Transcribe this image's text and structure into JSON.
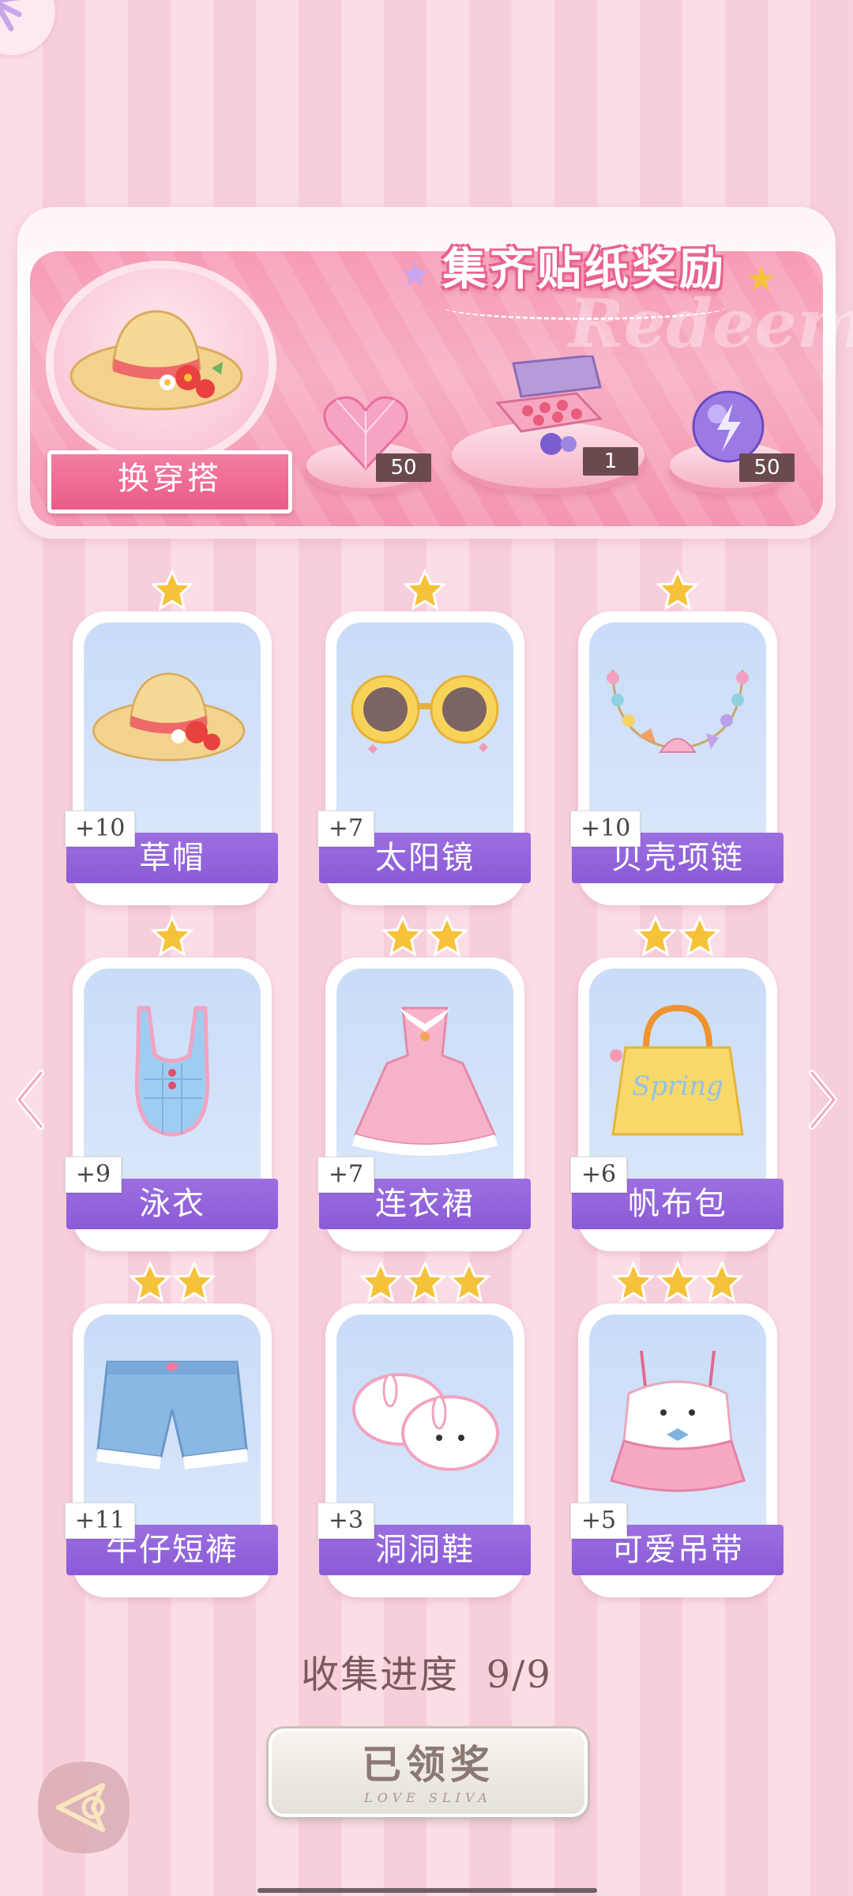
{
  "banner": {
    "title": "集齐贴纸奖励",
    "watermark": "Redeem",
    "outfit_button": "换穿搭",
    "rewards": [
      {
        "icon": "pink-heart-gem-icon",
        "qty": "50"
      },
      {
        "icon": "gift-box-icon",
        "qty": "1"
      },
      {
        "icon": "purple-lightning-orb-icon",
        "qty": "50"
      }
    ]
  },
  "items": [
    {
      "name": "草帽",
      "count": "+10",
      "stars": 1,
      "icon": "straw-hat-icon"
    },
    {
      "name": "太阳镜",
      "count": "+7",
      "stars": 1,
      "icon": "sunglasses-icon"
    },
    {
      "name": "贝壳项链",
      "count": "+10",
      "stars": 1,
      "icon": "shell-necklace-icon"
    },
    {
      "name": "泳衣",
      "count": "+9",
      "stars": 1,
      "icon": "swimsuit-icon"
    },
    {
      "name": "连衣裙",
      "count": "+7",
      "stars": 2,
      "icon": "dress-icon"
    },
    {
      "name": "帆布包",
      "count": "+6",
      "stars": 2,
      "icon": "canvas-bag-icon"
    },
    {
      "name": "牛仔短裤",
      "count": "+11",
      "stars": 2,
      "icon": "denim-shorts-icon"
    },
    {
      "name": "洞洞鞋",
      "count": "+3",
      "stars": 3,
      "icon": "clogs-icon"
    },
    {
      "name": "可爱吊带",
      "count": "+5",
      "stars": 3,
      "icon": "cute-camisole-icon"
    }
  ],
  "progress": {
    "label": "收集进度",
    "value": "9/9"
  },
  "claim_button": {
    "label": "已领奖",
    "sub": "LOVE SLIVA"
  },
  "colors": {
    "accent_pink": "#e95b87",
    "name_bar_purple": "#8a5bd6",
    "star_gold": "#f6c23a"
  }
}
